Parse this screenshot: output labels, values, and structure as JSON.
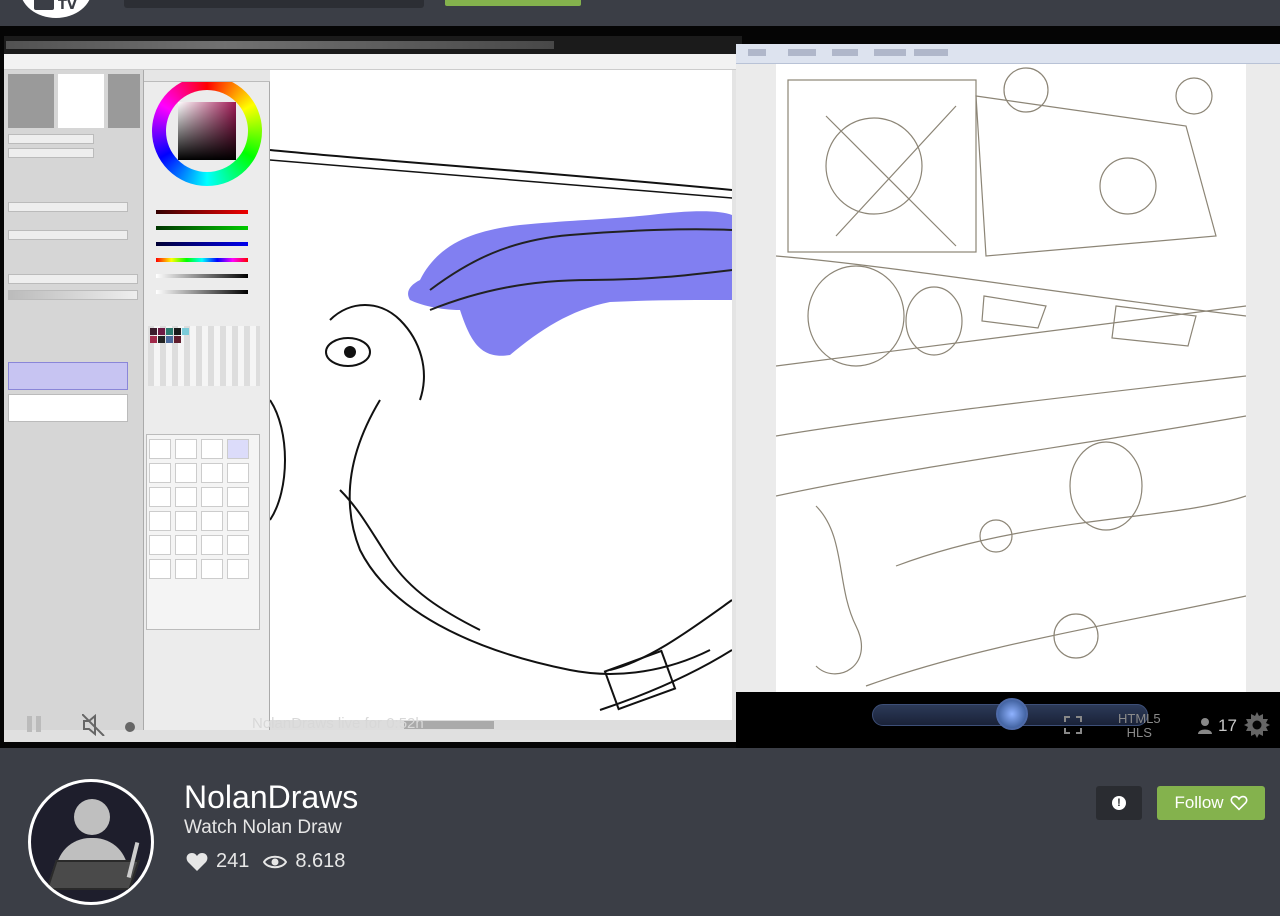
{
  "app": {
    "logo_text": "TV"
  },
  "player": {
    "overlay_title": "NolanDraws live for 0:52h",
    "format_line1": "HTML5",
    "format_line2": "HLS",
    "viewer_count": "17"
  },
  "channel": {
    "name": "NolanDraws",
    "subtitle": "Watch Nolan Draw",
    "likes": "241",
    "views": "8.618",
    "follow_label": "Follow"
  },
  "colors": {
    "background": "#3b3e46",
    "follow": "#84b24d",
    "report_bg": "#2a2c31",
    "brush_blue": "#7a78f0"
  },
  "icons": {
    "logo": "tv-logo-icon",
    "pause": "pause-icon",
    "mute": "mute-icon",
    "fullscreen": "fullscreen-icon",
    "viewers": "user-icon",
    "settings": "gear-icon",
    "likes": "heart-icon",
    "views": "eye-icon",
    "report": "alert-icon",
    "follow": "heart-outline-icon"
  }
}
